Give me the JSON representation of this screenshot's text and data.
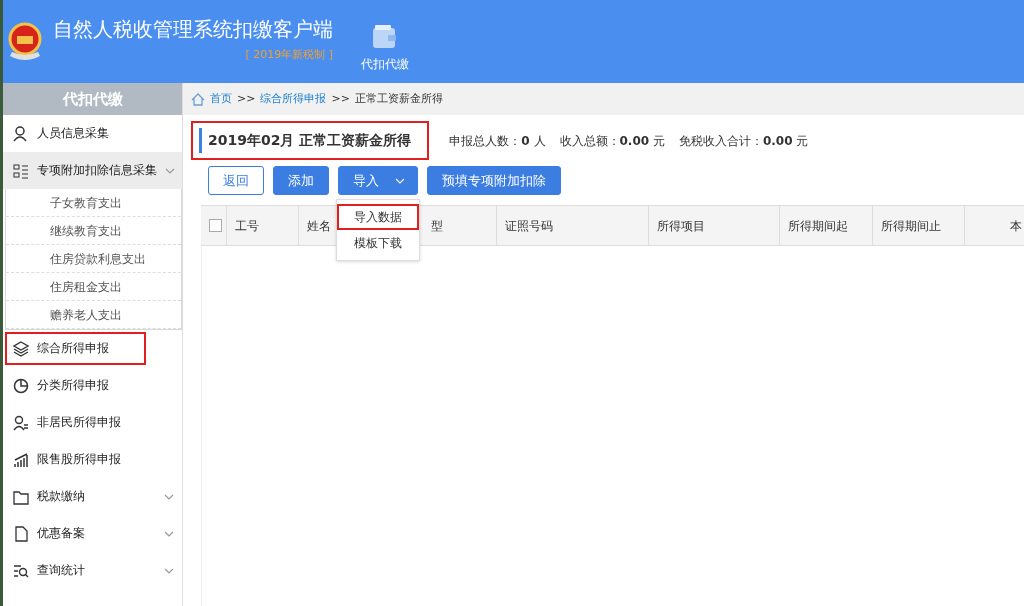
{
  "header": {
    "title": "自然人税收管理系统扣缴客户端",
    "subtitle": "[ 2019年新税制 ]",
    "modules": [
      {
        "label": "代扣代缴",
        "selected": true
      }
    ]
  },
  "sidebar": {
    "title": "代扣代缴",
    "items": [
      {
        "label": "人员信息采集",
        "kind": "item",
        "expandable": false,
        "highlighted": false
      },
      {
        "label": "专项附加扣除信息采集",
        "kind": "group",
        "expandable": true,
        "expanded": true,
        "highlighted": false,
        "children": [
          {
            "label": "子女教育支出"
          },
          {
            "label": "继续教育支出"
          },
          {
            "label": "住房贷款利息支出"
          },
          {
            "label": "住房租金支出"
          },
          {
            "label": "赡养老人支出"
          }
        ]
      },
      {
        "label": "综合所得申报",
        "kind": "item",
        "expandable": false,
        "highlighted": true
      },
      {
        "label": "分类所得申报",
        "kind": "item",
        "expandable": false,
        "highlighted": false
      },
      {
        "label": "非居民所得申报",
        "kind": "item",
        "expandable": false,
        "highlighted": false
      },
      {
        "label": "限售股所得申报",
        "kind": "item",
        "expandable": false,
        "highlighted": false
      },
      {
        "label": "税款缴纳",
        "kind": "item",
        "expandable": true,
        "highlighted": false
      },
      {
        "label": "优惠备案",
        "kind": "item",
        "expandable": true,
        "highlighted": false
      },
      {
        "label": "查询统计",
        "kind": "item",
        "expandable": true,
        "highlighted": false
      }
    ]
  },
  "breadcrumb": [
    {
      "label": "首页",
      "kind": "link"
    },
    {
      "label": ">>",
      "kind": "sep"
    },
    {
      "label": "综合所得申报",
      "kind": "link"
    },
    {
      "label": ">>",
      "kind": "sep"
    },
    {
      "label": "正常工资薪金所得",
      "kind": "current"
    }
  ],
  "page": {
    "title": "2019年02月 正常工资薪金所得",
    "highlighted": true,
    "stats": [
      "申报总人数：**0** 人",
      "收入总额：**0.00** 元",
      "免税收入合计：**0.00** 元"
    ]
  },
  "toolbar": [
    {
      "label": "返回",
      "kind": "outline"
    },
    {
      "label": "添加",
      "kind": "primary"
    },
    {
      "label": "导入",
      "kind": "dropdown",
      "expanded": true
    },
    {
      "label": "预填专项附加扣除",
      "kind": "primary"
    }
  ],
  "dropdown_menu": [
    {
      "label": "导入数据",
      "highlighted": true
    },
    {
      "label": "模板下载",
      "highlighted": false
    }
  ],
  "table": {
    "select_all_checked": false,
    "columns": [
      "工号",
      "姓名",
      "型",
      "证照号码",
      "所得项目",
      "所得期间起",
      "所得期间止",
      "本"
    ]
  }
}
